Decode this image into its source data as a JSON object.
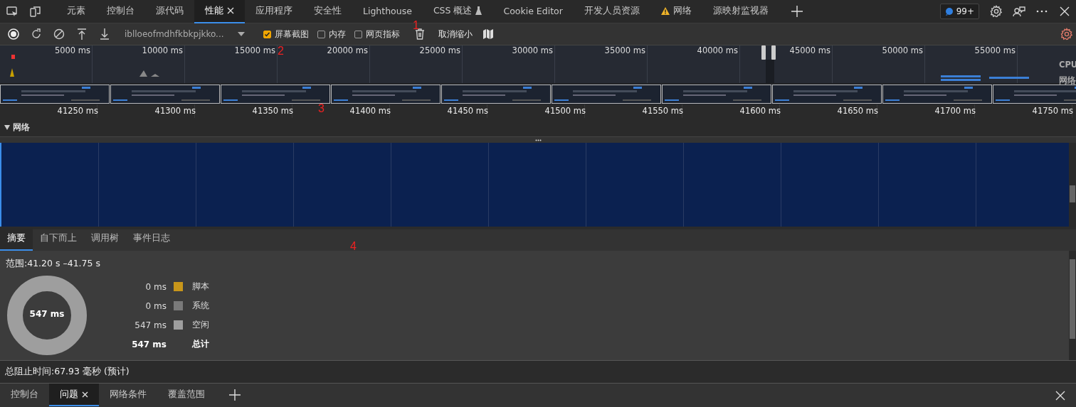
{
  "top_tabs": [
    {
      "label": "元素",
      "selected": false,
      "kind": "plain"
    },
    {
      "label": "控制台",
      "selected": false,
      "kind": "plain"
    },
    {
      "label": "源代码",
      "selected": false,
      "kind": "plain"
    },
    {
      "label": "性能",
      "selected": true,
      "kind": "closable"
    },
    {
      "label": "应用程序",
      "selected": false,
      "kind": "plain"
    },
    {
      "label": "安全性",
      "selected": false,
      "kind": "plain"
    },
    {
      "label": "Lighthouse",
      "selected": false,
      "kind": "plain"
    },
    {
      "label": "CSS 概述",
      "selected": false,
      "kind": "experimental"
    },
    {
      "label": "Cookie Editor",
      "selected": false,
      "kind": "plain"
    },
    {
      "label": "开发人员资源",
      "selected": false,
      "kind": "plain"
    },
    {
      "label": "网络",
      "selected": false,
      "kind": "warning"
    },
    {
      "label": "源映射监视器",
      "selected": false,
      "kind": "plain"
    }
  ],
  "issues_badge": "99+",
  "toolbar": {
    "profile": "iblloeofmdhfkbkpjkko...",
    "checkboxes": [
      {
        "label": "屏幕截图",
        "checked": true
      },
      {
        "label": "内存",
        "checked": false
      },
      {
        "label": "网页指标",
        "checked": false
      }
    ],
    "unzoom": "取消缩小"
  },
  "overview": {
    "ticks": [
      "5000 ms",
      "10000 ms",
      "15000 ms",
      "20000 ms",
      "25000 ms",
      "30000 ms",
      "35000 ms",
      "40000 ms",
      "45000 ms",
      "50000 ms",
      "55000 ms"
    ],
    "tracks": [
      "CPU",
      "网络"
    ]
  },
  "detail_ticks": [
    "41250 ms",
    "41300 ms",
    "41350 ms",
    "41400 ms",
    "41450 ms",
    "41500 ms",
    "41550 ms",
    "41600 ms",
    "41650 ms",
    "41700 ms",
    "41750 ms"
  ],
  "network_track": {
    "label": "网络",
    "expanded": true
  },
  "summary_tabs": [
    {
      "label": "摘要",
      "selected": true
    },
    {
      "label": "自下而上",
      "selected": false
    },
    {
      "label": "调用树",
      "selected": false
    },
    {
      "label": "事件日志",
      "selected": false
    }
  ],
  "summary": {
    "range": "范围:41.20 s –41.75 s",
    "donut_total": "547 ms",
    "rows": [
      {
        "value": "0 ms",
        "label": "脚本",
        "color": "#c8961a"
      },
      {
        "value": "0 ms",
        "label": "系统",
        "color": "#7a7a7a"
      },
      {
        "value": "547 ms",
        "label": "空闲",
        "color": "#9e9e9e"
      }
    ],
    "total": {
      "value": "547 ms",
      "label": "总计"
    }
  },
  "footer": "总阻止时间:67.93 毫秒 (预计)",
  "drawer_tabs": [
    {
      "label": "控制台",
      "selected": false,
      "kind": "plain"
    },
    {
      "label": "问题",
      "selected": true,
      "kind": "closable"
    },
    {
      "label": "网络条件",
      "selected": false,
      "kind": "plain"
    },
    {
      "label": "覆盖范围",
      "selected": false,
      "kind": "plain"
    }
  ],
  "annotations": [
    "1",
    "2",
    "3",
    "4"
  ]
}
